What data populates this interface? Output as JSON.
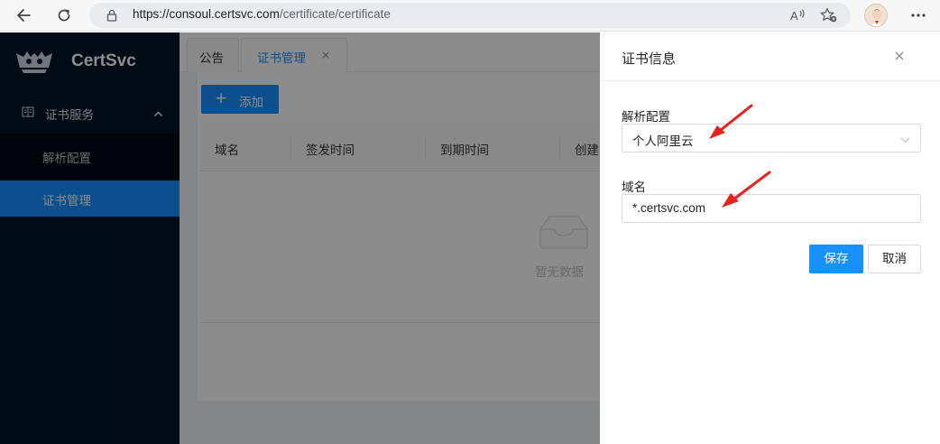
{
  "browser": {
    "url_host": "https://consoul.certsvc.com",
    "url_path": "/certificate/certificate"
  },
  "sidebar": {
    "brand": "CertSvc",
    "group_label": "证书服务",
    "items": [
      {
        "label": "解析配置"
      },
      {
        "label": "证书管理"
      }
    ]
  },
  "tabs": [
    {
      "label": "公告"
    },
    {
      "label": "证书管理",
      "close": "×"
    }
  ],
  "toolbar": {
    "add_label": "添加"
  },
  "table": {
    "columns": [
      "域名",
      "签发时间",
      "到期时间",
      "创建"
    ],
    "empty_text": "暂无数据"
  },
  "drawer": {
    "title": "证书信息",
    "close": "×",
    "fields": {
      "dns_label": "解析配置",
      "dns_value": "个人阿里云",
      "domain_label": "域名",
      "domain_value": "*.certsvc.com"
    },
    "save_label": "保存",
    "cancel_label": "取消"
  },
  "colors": {
    "primary": "#1890ff",
    "sidebar_bg": "#001529",
    "annotation_arrow": "#e8221b"
  }
}
